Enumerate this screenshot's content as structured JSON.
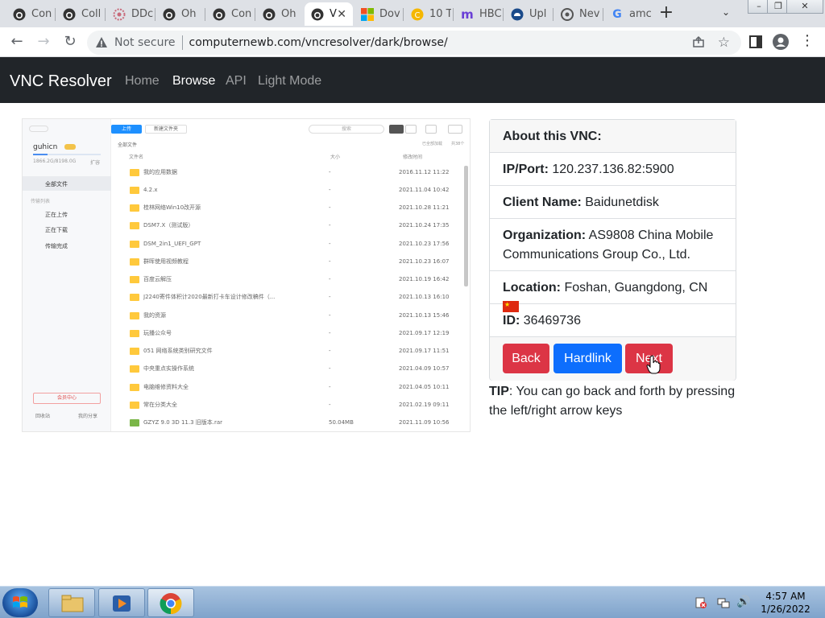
{
  "browser": {
    "tabs": [
      {
        "label": "Con",
        "icon": "github-icon"
      },
      {
        "label": "Coll",
        "icon": "github-icon"
      },
      {
        "label": "DDc",
        "icon": "flower-icon"
      },
      {
        "label": "Oh",
        "icon": "github-icon"
      },
      {
        "label": "Con",
        "icon": "github-icon"
      },
      {
        "label": "Oh",
        "icon": "github-icon"
      },
      {
        "label": "V",
        "icon": "github-icon",
        "active": true
      },
      {
        "label": "Dov",
        "icon": "microsoft-icon"
      },
      {
        "label": "10 T",
        "icon": "coin-icon"
      },
      {
        "label": "HBC",
        "icon": "m-logo-icon"
      },
      {
        "label": "Upl",
        "icon": "cloud-upload-icon"
      },
      {
        "label": "Nev",
        "icon": "chrome-icon"
      },
      {
        "label": "amc",
        "icon": "google-icon"
      }
    ],
    "security_label": "Not secure",
    "url": "computernewb.com/vncresolver/dark/browse/"
  },
  "navbar": {
    "brand": "VNC Resolver",
    "links": [
      {
        "label": "Home",
        "active": false
      },
      {
        "label": "Browse",
        "active": true
      },
      {
        "label": "API",
        "active": false
      },
      {
        "label": "Light Mode",
        "active": false
      }
    ]
  },
  "vnc_screenshot": {
    "user": "guhicn",
    "storage": "1866.2G/8198.0G",
    "expand_label": "扩容",
    "sidebar_items": [
      "全部文件",
      "传输列表",
      "正在上传",
      "正在下载",
      "传输完成"
    ],
    "vip_label": "会员中心",
    "bottom_left": "回收站",
    "bottom_right": "我的分享",
    "upload_label": "上传",
    "newfolder_label": "新建文件夹",
    "search_placeholder": "搜索",
    "breadcrumb": "全部文件",
    "loaded_label": "已全部加载",
    "count_label": "共38个",
    "col_name": "文件名",
    "col_size": "大小",
    "col_date": "修改时间",
    "files": [
      {
        "name": "我的应用数据",
        "size": "-",
        "date": "2016.11.12 11:22"
      },
      {
        "name": "4.2.x",
        "size": "-",
        "date": "2021.11.04 10:42"
      },
      {
        "name": "桂林网络Win10改开源",
        "size": "-",
        "date": "2021.10.28 11:21"
      },
      {
        "name": "DSM7.X（测试版）",
        "size": "-",
        "date": "2021.10.24 17:35"
      },
      {
        "name": "DSM_2in1_UEFI_GPT",
        "size": "-",
        "date": "2021.10.23 17:56"
      },
      {
        "name": "群晖使用视频教程",
        "size": "-",
        "date": "2021.10.23 16:07"
      },
      {
        "name": "百度云解压",
        "size": "-",
        "date": "2021.10.19 16:42"
      },
      {
        "name": "J2240寄件体积计2020最新打卡车设计修改稿件（...",
        "size": "-",
        "date": "2021.10.13 16:10"
      },
      {
        "name": "我的资源",
        "size": "-",
        "date": "2021.10.13 15:46"
      },
      {
        "name": "玩播公众号",
        "size": "-",
        "date": "2021.09.17 12:19"
      },
      {
        "name": "051 网络系统类别研究文件",
        "size": "-",
        "date": "2021.09.17 11:51"
      },
      {
        "name": "中央重点实操作系统",
        "size": "-",
        "date": "2021.04.09 10:57"
      },
      {
        "name": "电脑维修资料大全",
        "size": "-",
        "date": "2021.04.05 10:11"
      },
      {
        "name": "常在分类大全",
        "size": "-",
        "date": "2021.02.19 09:11"
      },
      {
        "name": "GZYZ 9.0 3D 11.3 旧版本.rar",
        "size": "50.04MB",
        "date": "2021.11.09 10:56"
      }
    ]
  },
  "card": {
    "header": "About this VNC:",
    "ip_label": "IP/Port:",
    "ip_value": "120.237.136.82:5900",
    "client_label": "Client Name:",
    "client_value": "Baidunetdisk",
    "org_label": "Organization:",
    "org_value": "AS9808 China Mobile Communications Group Co., Ltd.",
    "location_label": "Location:",
    "location_value": "Foshan, Guangdong, CN",
    "id_label": "ID:",
    "id_value": "36469736",
    "buttons": {
      "back": "Back",
      "hardlink": "Hardlink",
      "next": "Next"
    },
    "colors": {
      "back": "#dc3545",
      "hardlink": "#0d6efd",
      "next": "#dc3545"
    }
  },
  "tip": {
    "label": "TIP",
    "text": ": You can go back and forth by pressing the left/right arrow keys"
  },
  "taskbar": {
    "time": "4:57 AM",
    "date": "1/26/2022"
  }
}
